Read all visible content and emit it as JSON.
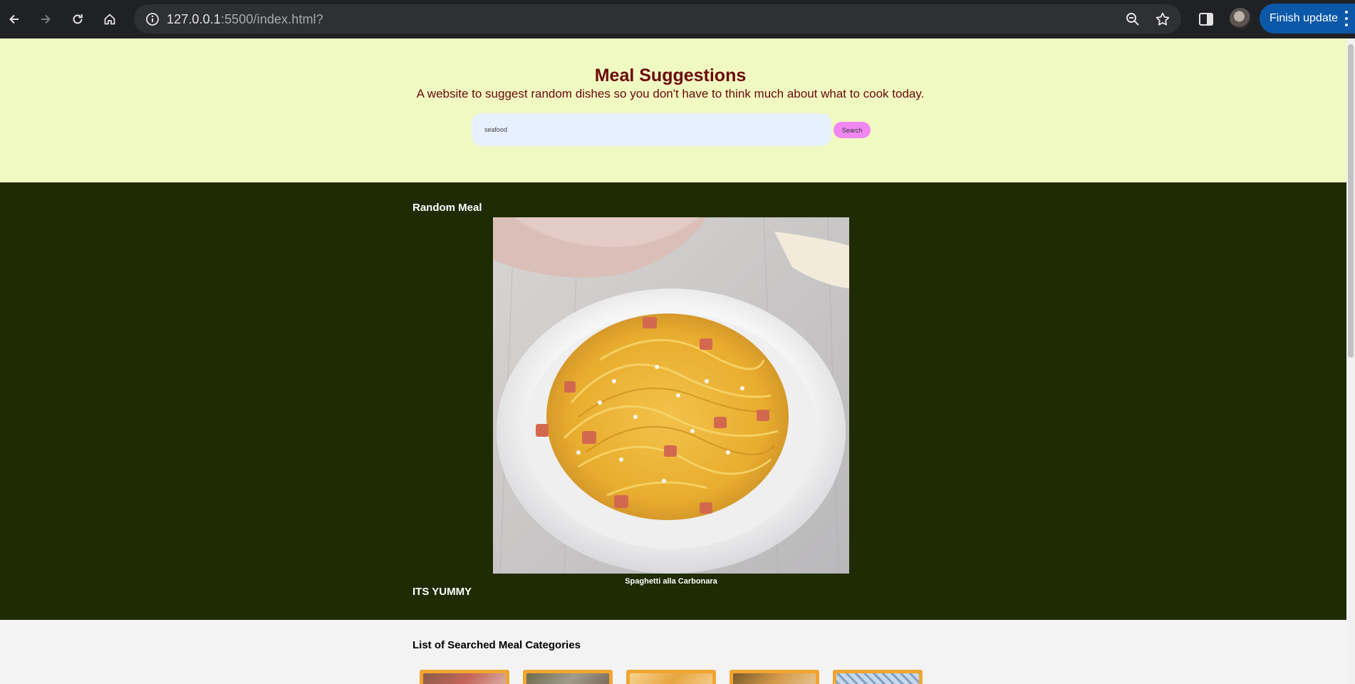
{
  "browser": {
    "url_host": "127.0.0.1",
    "url_rest": ":5500/index.html?",
    "finish_update_label": "Finish update",
    "icons": [
      "back-icon",
      "forward-icon",
      "reload-icon",
      "home-icon",
      "info-icon",
      "zoom-icon",
      "star-icon",
      "side-panel-icon",
      "more-icon"
    ]
  },
  "header": {
    "title": "Meal Suggestions",
    "subtitle": "A website to suggest random dishes so you don't have to think much about what to cook today.",
    "search_value": "seafood",
    "search_button": "Search"
  },
  "random_meal": {
    "section_title": "Random Meal",
    "meal_name": "Spaghetti alla Carbonara",
    "tagline": "ITS YUMMY"
  },
  "categories": {
    "section_title": "List of Searched Meal Categories",
    "card_count_visible": 5
  },
  "colors": {
    "header_bg": "#f1f9c3",
    "title_color": "#6a0a08",
    "random_bg": "#1f2b03",
    "search_btn": "#f088f1",
    "card_border": "#f0a531",
    "finish_update_bg": "#0b57a8"
  }
}
